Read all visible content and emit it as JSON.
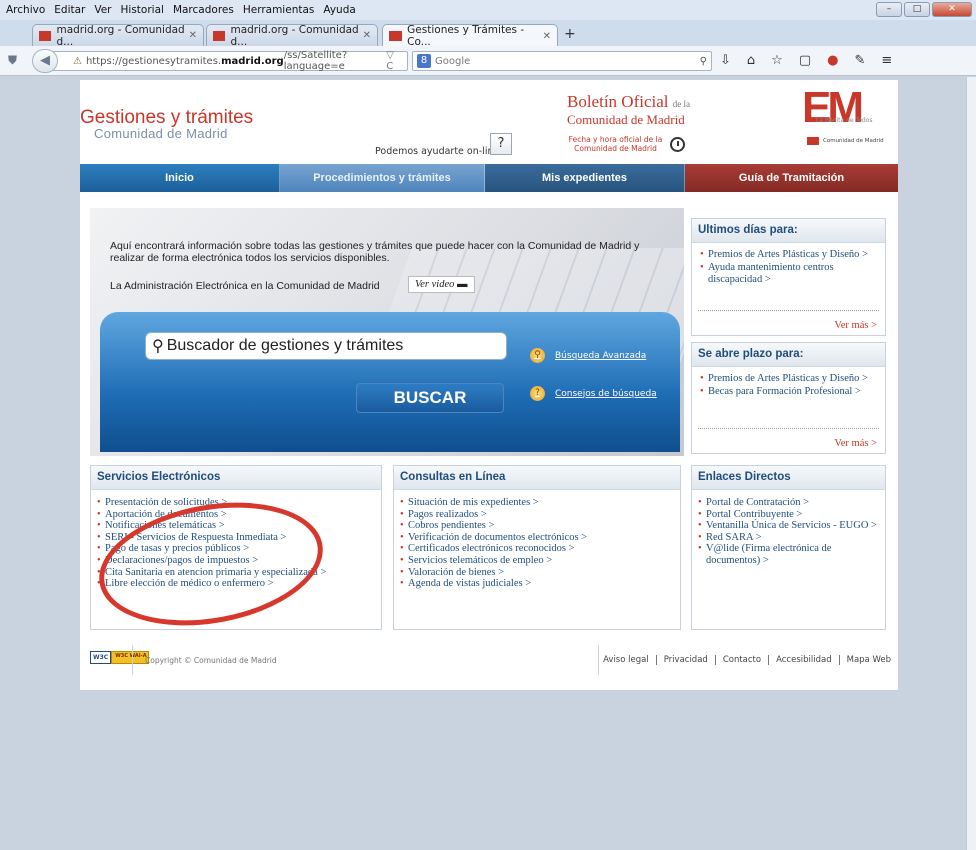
{
  "menubar": [
    "Archivo",
    "Editar",
    "Ver",
    "Historial",
    "Marcadores",
    "Herramientas",
    "Ayuda"
  ],
  "tabs": [
    {
      "label": "madrid.org - Comunidad d..."
    },
    {
      "label": "madrid.org - Comunidad d..."
    },
    {
      "label": "Gestiones y Trámites - Co..."
    }
  ],
  "urlbar": {
    "prefix": "https://gestionesytramites.",
    "domain": "madrid.org",
    "suffix": "/ss/Satellite?language=e"
  },
  "searchbar": {
    "engine": "Google"
  },
  "header": {
    "title": "Gestiones y trámites",
    "subtitle": "Comunidad de Madrid",
    "help_text": "Podemos ayudarte on-line",
    "help_button": "?",
    "boletin_title": "Boletín Oficial",
    "boletin_de": "de la",
    "boletin_sub": "Comunidad de Madrid",
    "fecha": "Fecha y hora oficial de la Comunidad de Madrid",
    "em_logo": "EM",
    "em_sub": "La Bonita de Todos",
    "cm_logo": "Comunidad de Madrid"
  },
  "nav": [
    {
      "label": "Inicio"
    },
    {
      "label": "Procedimientos y trámites"
    },
    {
      "label": "Mis expedientes"
    },
    {
      "label": "Guía de Tramitación"
    }
  ],
  "hero": {
    "intro": "Aquí encontrará información sobre todas las gestiones y trámites que puede hacer con la Comunidad de Madrid y realizar de forma electrónica todos los servicios disponibles.",
    "admin": "La Administración Electrónica en la Comunidad de Madrid",
    "video": "Ver video",
    "search_placeholder": "Buscador de gestiones y trámites",
    "search_button": "BUSCAR",
    "advanced": "Búsqueda Avanzada",
    "tips": "Consejos de búsqueda"
  },
  "ultimos": {
    "title": "Ultimos días para:",
    "items": [
      "Premios de Artes Plásticas y Diseño >",
      "Ayuda mantenimiento centros discapacidad >"
    ],
    "more": "Ver más >"
  },
  "plazo": {
    "title": "Se abre plazo para:",
    "items": [
      "Premios de Artes Plásticas y Diseño >",
      "Becas para Formación Profesional >"
    ],
    "more": "Ver más >"
  },
  "servicios": {
    "title": "Servicios Electrónicos",
    "items": [
      "Presentación de solicitudes >",
      "Aportación de documentos >",
      "Notificaciones telemáticas >",
      "SERI - Servicios de Respuesta Inmediata >",
      "Pago de tasas y precios públicos >",
      "Declaraciones/pagos de impuestos >",
      "Cita Sanitaria en atencion primaria y especializada >",
      "Libre elección de médico o enfermero >"
    ]
  },
  "consultas": {
    "title": "Consultas en Línea",
    "items": [
      "Situación de mis expedientes >",
      "Pagos realizados >",
      "Cobros pendientes >",
      "Verificación de documentos electrónicos >",
      "Certificados electrónicos reconocidos >",
      "Servicios telemáticos de empleo >",
      "Valoración de bienes >",
      "Agenda de vistas judiciales >"
    ]
  },
  "enlaces": {
    "title": "Enlaces Directos",
    "items": [
      "Portal de Contratación >",
      "Portal Contribuyente >",
      "Ventanilla Única de Servicios - EUGO >",
      "Red SARA >",
      "V@lide (Firma electrónica de documentos) >"
    ]
  },
  "footer": {
    "wai_badge": "W3C WAI-A WCAG 1.0",
    "copyright": "Copyright © Comunidad de Madrid",
    "links": [
      "Aviso legal",
      "Privacidad",
      "Contacto",
      "Accesibilidad",
      "Mapa Web"
    ]
  }
}
